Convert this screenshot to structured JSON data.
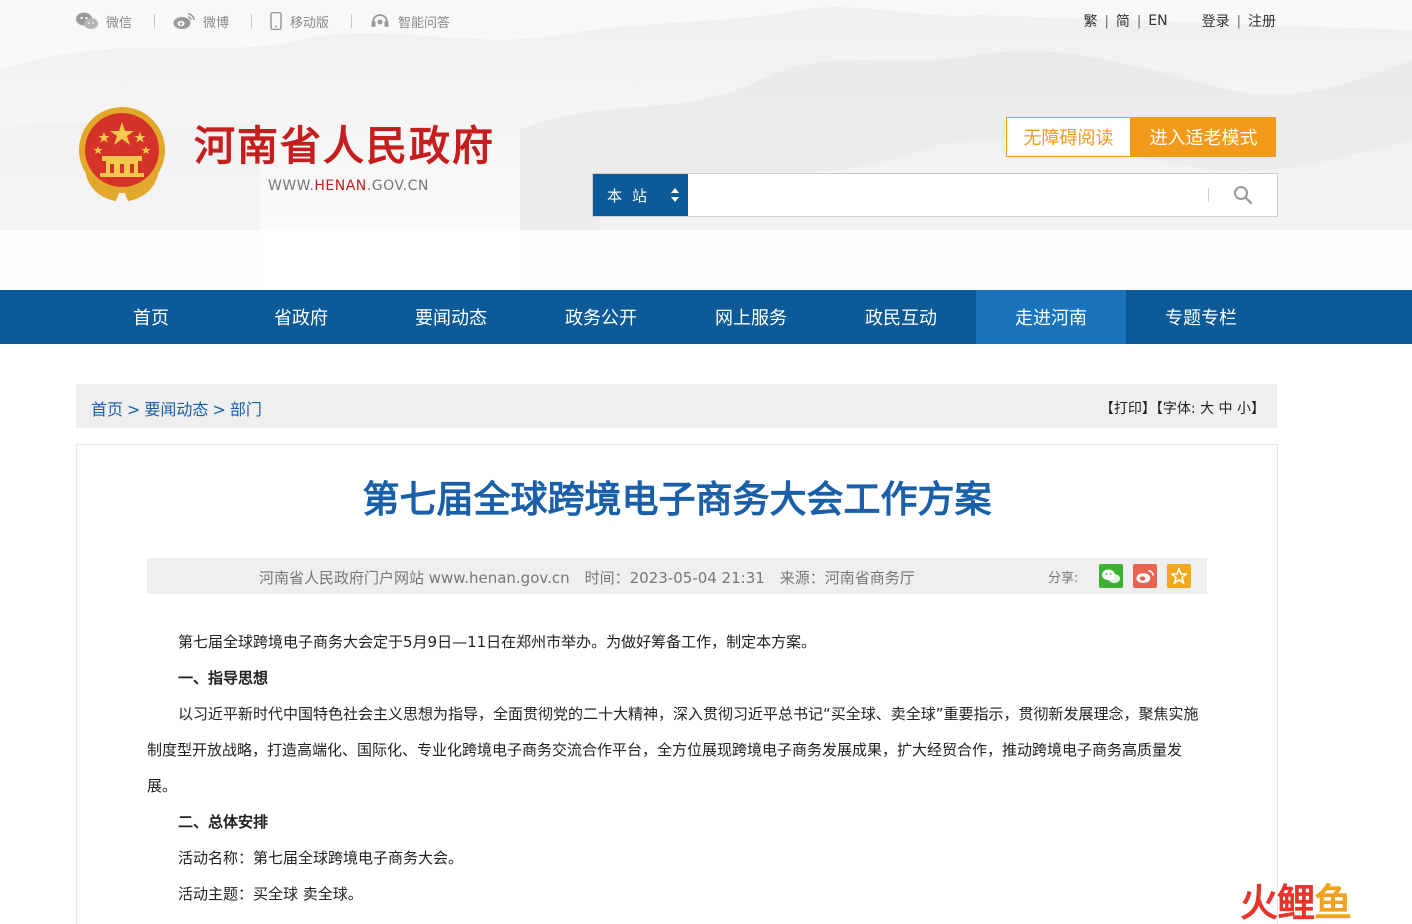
{
  "topbar": {
    "left": [
      {
        "label": "微信",
        "icon": "wechat-icon"
      },
      {
        "label": "微博",
        "icon": "weibo-icon"
      },
      {
        "label": "移动版",
        "icon": "mobile-icon"
      },
      {
        "label": "智能问答",
        "icon": "headset-icon"
      }
    ],
    "lang": {
      "traditional": "繁",
      "simplified": "简",
      "english": "EN"
    },
    "auth": {
      "login": "登录",
      "register": "注册"
    }
  },
  "logo": {
    "title": "河南省人民政府",
    "url_prefix": "WWW.",
    "url_highlight": "HENAN",
    "url_suffix": ".GOV.CN"
  },
  "modes": {
    "accessible": "无障碍阅读",
    "elder": "进入适老模式"
  },
  "search": {
    "scope": "本站",
    "placeholder": "",
    "value": ""
  },
  "nav": [
    {
      "label": "首页",
      "active": false
    },
    {
      "label": "省政府",
      "active": false
    },
    {
      "label": "要闻动态",
      "active": false
    },
    {
      "label": "政务公开",
      "active": false
    },
    {
      "label": "网上服务",
      "active": false
    },
    {
      "label": "政民互动",
      "active": false
    },
    {
      "label": "走进河南",
      "active": true
    },
    {
      "label": "专题专栏",
      "active": false
    }
  ],
  "breadcrumb": {
    "home": "首页",
    "level1": "要闻动态",
    "level2": "部门",
    "separator": ">"
  },
  "tools": {
    "print": "【打印】",
    "font_open": "【字体:",
    "font_large": "大",
    "font_mid": "中",
    "font_small": "小",
    "font_close": "】"
  },
  "article": {
    "title": "第七届全球跨境电子商务大会工作方案",
    "meta_site": "河南省人民政府门户网站 www.henan.gov.cn",
    "meta_time": "时间：2023-05-04 21:31",
    "meta_source": "来源：河南省商务厅",
    "share_label": "分享:",
    "paragraphs": [
      {
        "text": "第七届全球跨境电子商务大会定于5月9日—11日在郑州市举办。为做好筹备工作，制定本方案。",
        "heading": false
      },
      {
        "text": "一、指导思想",
        "heading": true
      },
      {
        "text": "以习近平新时代中国特色社会主义思想为指导，全面贯彻党的二十大精神，深入贯彻习近平总书记“买全球、卖全球”重要指示，贯彻新发展理念，聚焦实施制度型开放战略，打造高端化、国际化、专业化跨境电子商务交流合作平台，全方位展现跨境电子商务发展成果，扩大经贸合作，推动跨境电子商务高质量发展。",
        "heading": false
      },
      {
        "text": "二、总体安排",
        "heading": true
      },
      {
        "text": "活动名称：第七届全球跨境电子商务大会。",
        "heading": false
      },
      {
        "text": "活动主题：买全球 卖全球。",
        "heading": false
      }
    ]
  },
  "watermark": {
    "char1": "火",
    "char2": "鲤",
    "char3": "鱼"
  },
  "colors": {
    "brand_blue": "#0d5a98",
    "nav_active": "#1a73bb",
    "title_red": "#c51e1e",
    "orange": "#f29a1c",
    "link_blue": "#1a5fa8"
  }
}
